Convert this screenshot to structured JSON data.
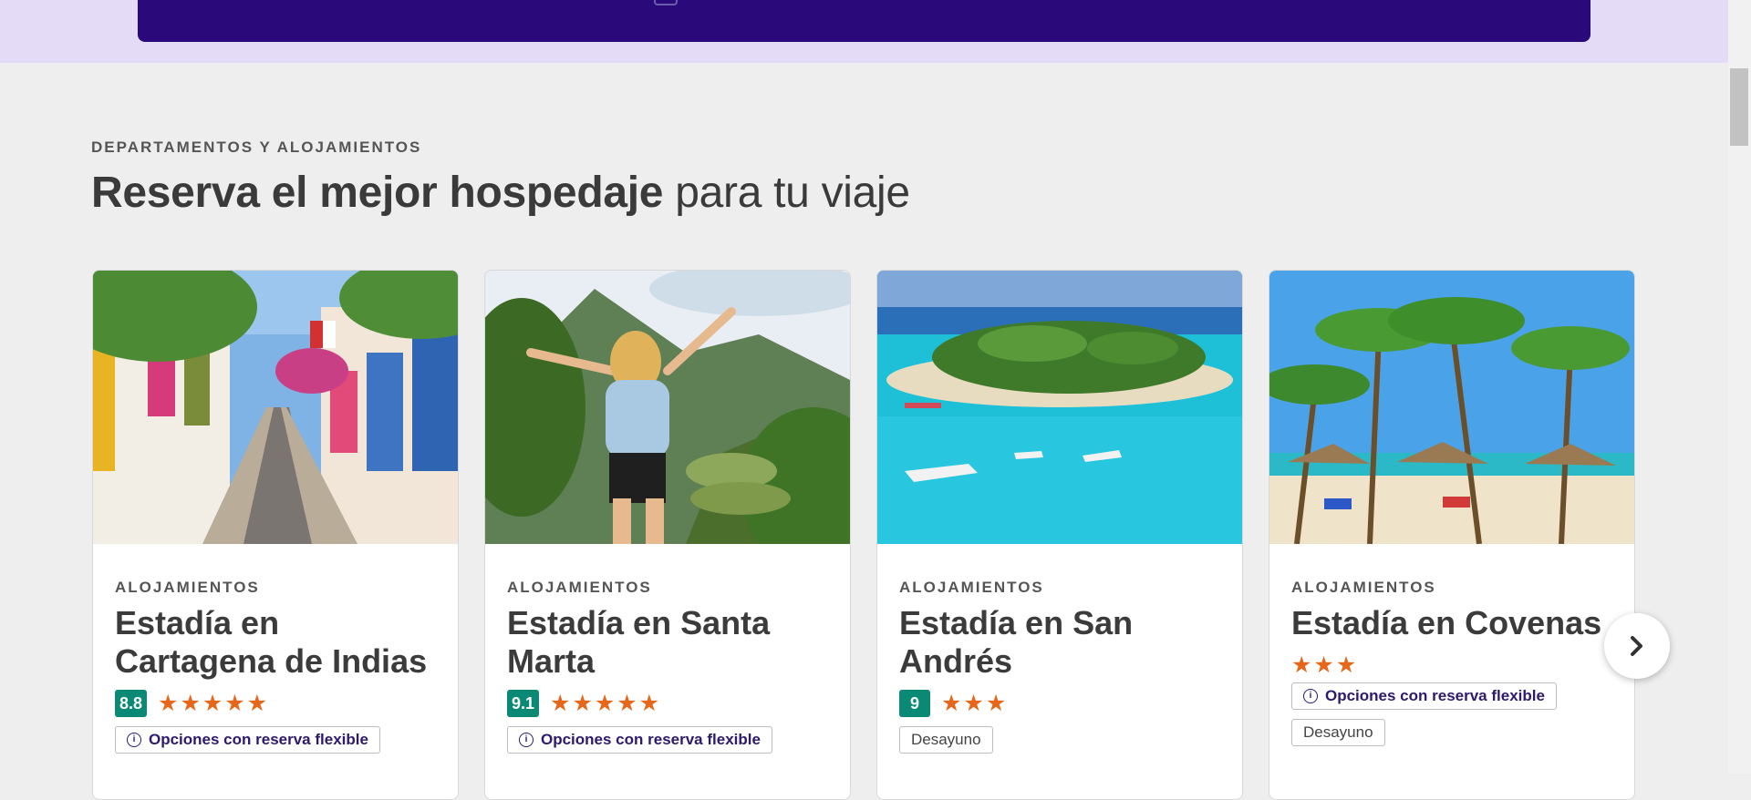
{
  "section": {
    "eyebrow": "DEPARTAMENTOS Y ALOJAMIENTOS",
    "headline_bold": "Reserva el mejor hospedaje",
    "headline_light": "para tu viaje"
  },
  "cards": [
    {
      "category": "ALOJAMIENTOS",
      "title": "Estadía en Cartagena de Indias",
      "score": "8.8",
      "stars": "★★★★★",
      "tags": [
        "Opciones con reserva flexible"
      ]
    },
    {
      "category": "ALOJAMIENTOS",
      "title": "Estadía en Santa Marta",
      "score": "9.1",
      "stars": "★★★★★",
      "tags": [
        "Opciones con reserva flexible"
      ]
    },
    {
      "category": "ALOJAMIENTOS",
      "title": "Estadía en San Andrés",
      "score": "9",
      "stars": "★★★",
      "tags": [
        "Desayuno"
      ]
    },
    {
      "category": "ALOJAMIENTOS",
      "title": "Estadía en Covenas",
      "stars": "★★★",
      "tags": [
        "Opciones con reserva flexible",
        "Desayuno"
      ]
    }
  ],
  "icons": {
    "info": "info-icon",
    "next": "chevron-right-icon"
  },
  "colors": {
    "promo_bar": "#2a0a7a",
    "top_band": "#e4dcf6",
    "score_badge": "#0a8a74",
    "stars": "#e6671a",
    "tag_text": "#2b1a6e"
  }
}
